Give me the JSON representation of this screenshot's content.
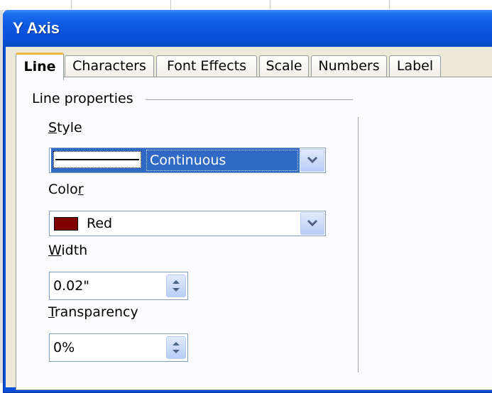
{
  "dialog": {
    "title": "Y Axis"
  },
  "tabs": [
    {
      "label": "Line",
      "active": true
    },
    {
      "label": "Characters"
    },
    {
      "label": "Font Effects"
    },
    {
      "label": "Scale"
    },
    {
      "label": "Numbers"
    },
    {
      "label": "Label"
    }
  ],
  "line_properties": {
    "group_label": "Line properties",
    "style": {
      "label_mnemonic": "S",
      "label_rest": "tyle",
      "value": "Continuous"
    },
    "color": {
      "label_start": "Colo",
      "label_mnemonic": "r",
      "value": "Red",
      "swatch": "#800000"
    },
    "width": {
      "label_mnemonic": "W",
      "label_rest": "idth",
      "value": "0.02\""
    },
    "transparency": {
      "label_mnemonic": "T",
      "label_rest": "ransparency",
      "value": "0%"
    }
  },
  "colors": {
    "title_bar": "#0a4fd8",
    "selection": "#316ac5",
    "tab_accent": "#f5b93c",
    "dialog_bg": "#ece9d8"
  }
}
